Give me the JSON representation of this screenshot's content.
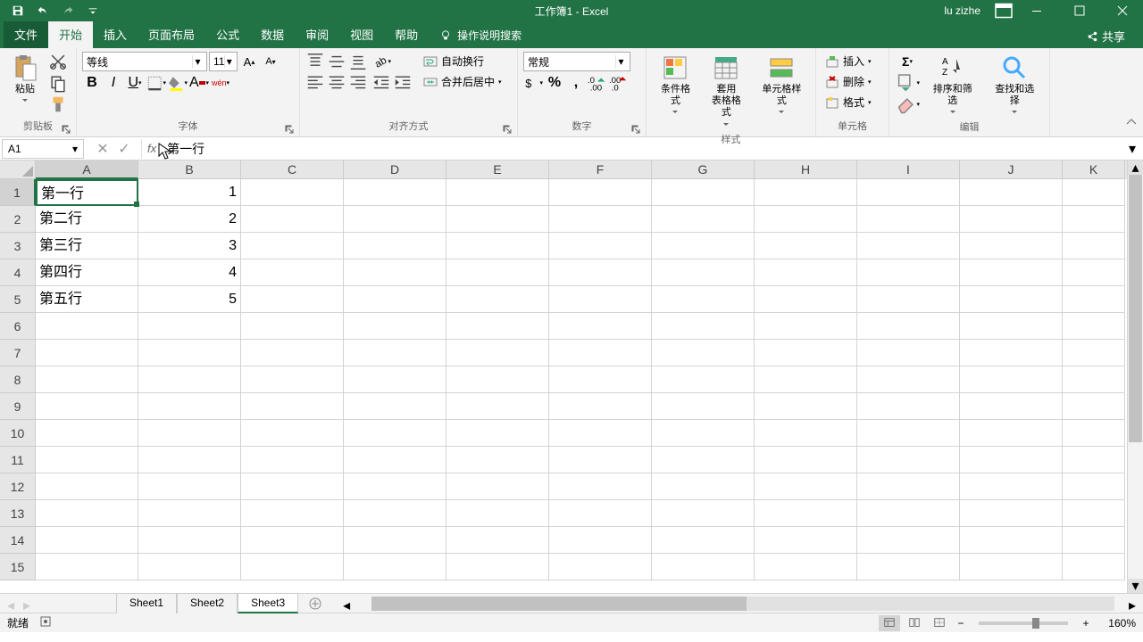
{
  "title": "工作簿1 - Excel",
  "user": "lu zizhe",
  "tabs": {
    "file": "文件",
    "home": "开始",
    "insert": "插入",
    "layout": "页面布局",
    "formulas": "公式",
    "data": "数据",
    "review": "审阅",
    "view": "视图",
    "help": "帮助",
    "tellme": "操作说明搜索",
    "share": "共享"
  },
  "ribbon": {
    "clipboard": {
      "label": "剪贴板",
      "paste": "粘贴"
    },
    "font": {
      "label": "字体",
      "name": "等线",
      "size": "11"
    },
    "align": {
      "label": "对齐方式",
      "wrap": "自动换行",
      "merge": "合并后居中"
    },
    "number": {
      "label": "数字",
      "format": "常规"
    },
    "styles": {
      "label": "样式",
      "cond": "条件格式",
      "table": "套用\n表格格式",
      "cell": "单元格样式"
    },
    "cells": {
      "label": "单元格",
      "insert": "插入",
      "delete": "删除",
      "format": "格式"
    },
    "editing": {
      "label": "编辑",
      "sort": "排序和筛选",
      "find": "查找和选择"
    }
  },
  "nameBox": "A1",
  "formula": "第一行",
  "columns": [
    "A",
    "B",
    "C",
    "D",
    "E",
    "F",
    "G",
    "H",
    "I",
    "J",
    "K"
  ],
  "rows": [
    {
      "n": "1",
      "a": "第一行",
      "b": "1"
    },
    {
      "n": "2",
      "a": "第二行",
      "b": "2"
    },
    {
      "n": "3",
      "a": "第三行",
      "b": "3"
    },
    {
      "n": "4",
      "a": "第四行",
      "b": "4"
    },
    {
      "n": "5",
      "a": "第五行",
      "b": "5"
    },
    {
      "n": "6",
      "a": "",
      "b": ""
    },
    {
      "n": "7",
      "a": "",
      "b": ""
    },
    {
      "n": "8",
      "a": "",
      "b": ""
    },
    {
      "n": "9",
      "a": "",
      "b": ""
    },
    {
      "n": "10",
      "a": "",
      "b": ""
    },
    {
      "n": "11",
      "a": "",
      "b": ""
    },
    {
      "n": "12",
      "a": "",
      "b": ""
    },
    {
      "n": "13",
      "a": "",
      "b": ""
    },
    {
      "n": "14",
      "a": "",
      "b": ""
    },
    {
      "n": "15",
      "a": "",
      "b": ""
    }
  ],
  "sheets": [
    "Sheet1",
    "Sheet2",
    "Sheet3"
  ],
  "activeSheet": 2,
  "status": "就绪",
  "zoom": "160%"
}
